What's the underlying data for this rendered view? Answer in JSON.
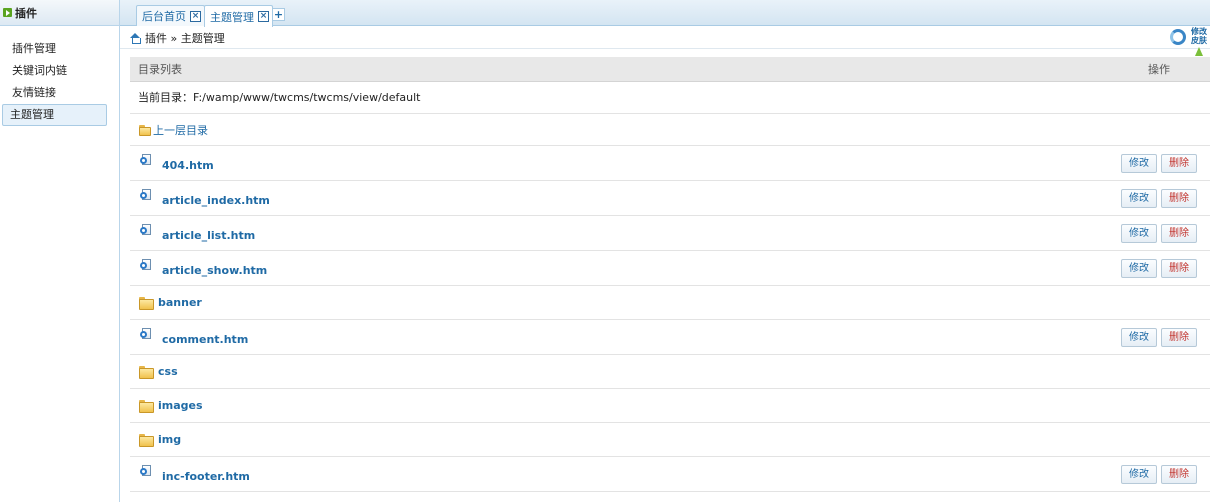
{
  "sidebar": {
    "title": "插件",
    "items": [
      {
        "label": "插件管理",
        "active": false
      },
      {
        "label": "关键词内链",
        "active": false
      },
      {
        "label": "友情链接",
        "active": false
      },
      {
        "label": "主题管理",
        "active": true
      }
    ]
  },
  "tabs": [
    {
      "label": "后台首页",
      "close": "×"
    },
    {
      "label": "主题管理",
      "close": "×",
      "active": true
    }
  ],
  "tab_add": "+",
  "breadcrumb": {
    "text": "插件 » 主题管理"
  },
  "toolbar": {
    "edit_label_1": "修改",
    "edit_label_2": "皮肤"
  },
  "table": {
    "header_name": "目录列表",
    "header_op": "操作",
    "current_dir": "当前目录：F:/wamp/www/twcms/twcms/view/default",
    "up_dir": "上一层目录",
    "edit_label": "修改",
    "delete_label": "删除",
    "rows": [
      {
        "name": "404.htm",
        "type": "file"
      },
      {
        "name": "article_index.htm",
        "type": "file"
      },
      {
        "name": "article_list.htm",
        "type": "file"
      },
      {
        "name": "article_show.htm",
        "type": "file"
      },
      {
        "name": "banner",
        "type": "dir"
      },
      {
        "name": "comment.htm",
        "type": "file"
      },
      {
        "name": "css",
        "type": "dir"
      },
      {
        "name": "images",
        "type": "dir"
      },
      {
        "name": "img",
        "type": "dir"
      },
      {
        "name": "inc-footer.htm",
        "type": "file"
      }
    ]
  }
}
